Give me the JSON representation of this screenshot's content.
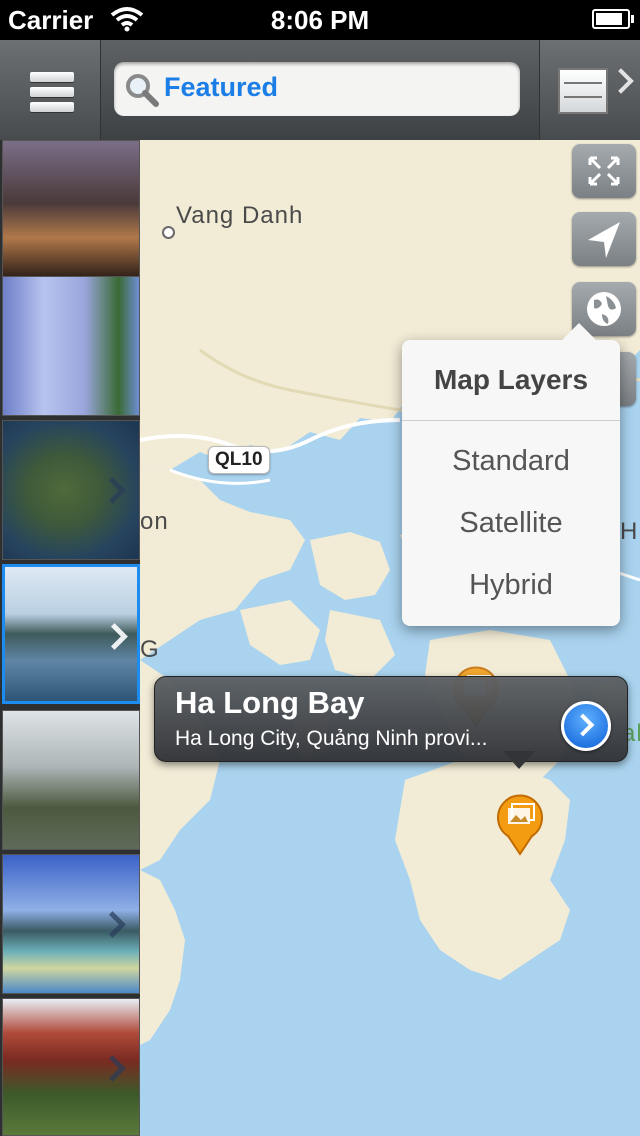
{
  "status_bar": {
    "carrier": "Carrier",
    "time": "8:06 PM"
  },
  "navbar": {
    "search_label": "Featured"
  },
  "map": {
    "labels": {
      "vang_danh": "Vang Danh",
      "road": "QL10",
      "left_fragment": "on",
      "left_g": "G",
      "right_h": "H",
      "right_alon": "alon"
    }
  },
  "map_layers": {
    "title": "Map Layers",
    "options": [
      "Standard",
      "Satellite",
      "Hybrid"
    ]
  },
  "callout": {
    "title": "Ha Long Bay",
    "subtitle": "Ha Long City, Quảng Ninh provi..."
  },
  "icons": [
    "menu-icon",
    "search-icon",
    "list-view-icon",
    "fullscreen-icon",
    "locate-icon",
    "globe-icon",
    "photo-pin-icon",
    "disclosure-icon",
    "wifi-icon",
    "battery-icon"
  ],
  "colors": {
    "accent": "#1a7ee6",
    "water": "#a9d3ef",
    "land": "#f2ecd6",
    "pin": "#f39c12",
    "selected_border": "#1c8cf0"
  }
}
